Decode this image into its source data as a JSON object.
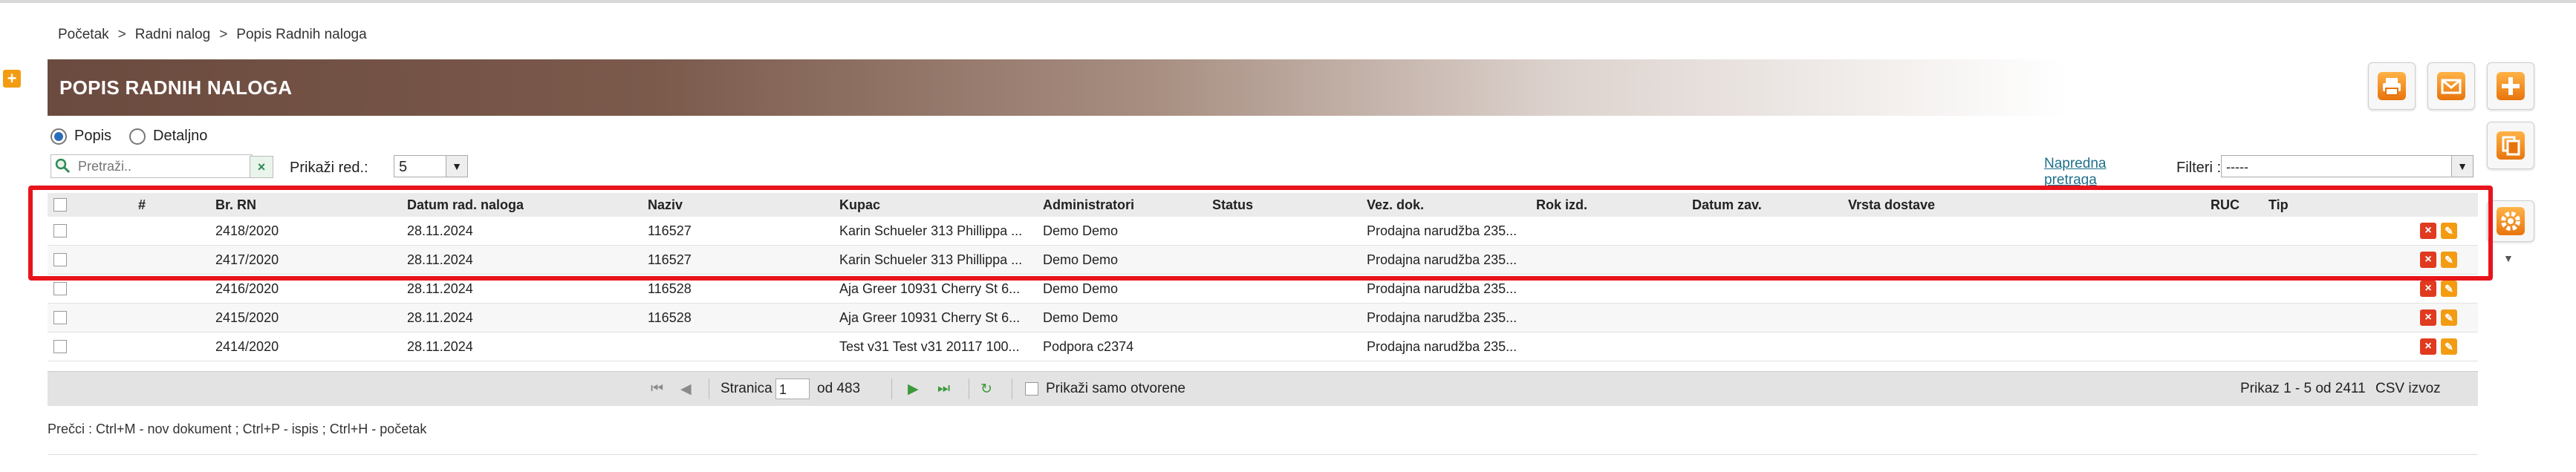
{
  "breadcrumb": [
    "Početak",
    "Radni nalog",
    "Popis Radnih naloga"
  ],
  "breadcrumb_sep": ">",
  "side_plus_label": "+",
  "title": "POPIS RADNIH NALOGA",
  "toolbar": {
    "print_icon": "printer-icon",
    "mail_icon": "mail-icon",
    "add_icon": "plus-icon",
    "copy_icon": "copy-icon",
    "settings_icon": "gear-icon"
  },
  "view_mode": {
    "popis": "Popis",
    "detaljno": "Detaljno",
    "selected": "Popis"
  },
  "search": {
    "placeholder": "Pretraži..",
    "clear": "×"
  },
  "rows_label": "Prikaži red.:",
  "rows_value": "5",
  "advanced_search": "Napredna pretraga",
  "filters_label": "Filteri :",
  "filters_value": "-----",
  "table": {
    "columns": [
      "#",
      "Br. RN",
      "Datum rad. naloga",
      "Naziv",
      "Kupac",
      "Administratori",
      "Status",
      "Vez. dok.",
      "Rok izd.",
      "Datum zav.",
      "Vrsta dostave",
      "RUC",
      "Tip"
    ],
    "rows": [
      {
        "br_rn": "2418/2020",
        "datum": "28.11.2024",
        "naziv": "116527",
        "kupac": "Karin Schueler 313 Phillippa ...",
        "admin": "Demo Demo",
        "vez_dok": "Prodajna narudžba 235..."
      },
      {
        "br_rn": "2417/2020",
        "datum": "28.11.2024",
        "naziv": "116527",
        "kupac": "Karin Schueler 313 Phillippa ...",
        "admin": "Demo Demo",
        "vez_dok": "Prodajna narudžba 235..."
      },
      {
        "br_rn": "2416/2020",
        "datum": "28.11.2024",
        "naziv": "116528",
        "kupac": "Aja Greer 10931 Cherry St 6...",
        "admin": "Demo Demo",
        "vez_dok": "Prodajna narudžba 235..."
      },
      {
        "br_rn": "2415/2020",
        "datum": "28.11.2024",
        "naziv": "116528",
        "kupac": "Aja Greer 10931 Cherry St 6...",
        "admin": "Demo Demo",
        "vez_dok": "Prodajna narudžba 235..."
      },
      {
        "br_rn": "2414/2020",
        "datum": "28.11.2024",
        "naziv": "",
        "kupac": "Test v31 Test v31 20117 100...",
        "admin": "Podpora c2374",
        "vez_dok": "Prodajna narudžba 235..."
      }
    ],
    "delete_label": "×",
    "edit_label": "✎"
  },
  "pager": {
    "page_label": "Stranica",
    "page_value": "1",
    "of_label": "od 483",
    "only_open_label": "Prikaži samo otvorene",
    "summary": "Prikaz 1 - 5 od 2411",
    "csv": "CSV izvoz"
  },
  "shortcuts": "Prečci : Ctrl+M - nov dokument ;  Ctrl+P - ispis ;  Ctrl+H - početak",
  "colors": {
    "banner": "#6b4a3f",
    "accent": "#f39c12",
    "highlight": "#e8141b",
    "delete": "#e03a1f"
  }
}
